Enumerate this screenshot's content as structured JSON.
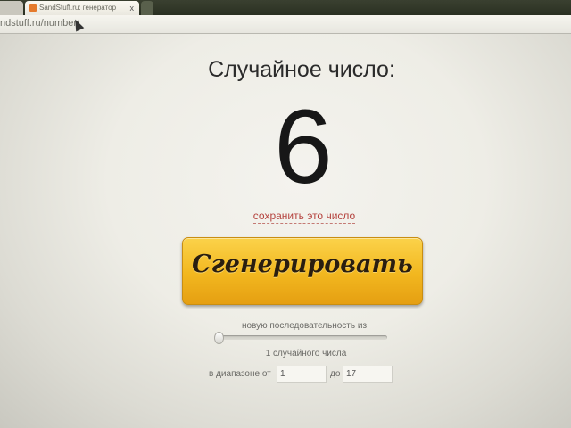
{
  "browser": {
    "active_tab_title": "SandStuff.ru: генератор",
    "tab_close": "x",
    "address": "ndstuff.ru/number/"
  },
  "page": {
    "heading": "Случайное число:",
    "number": "6",
    "save_link": "сохранить это число",
    "generate_button": "Сгенерировать",
    "sequence_label": "новую последовательность из",
    "count_label": "1 случайного числа",
    "range_from_label": "в диапазоне от",
    "range_from_value": "1",
    "range_to_label": "до",
    "range_to_value": "17",
    "count_slider_level": 0
  },
  "colors": {
    "button": "#f2b71f",
    "link": "#b5443f",
    "favicon": "#e57a2c"
  }
}
